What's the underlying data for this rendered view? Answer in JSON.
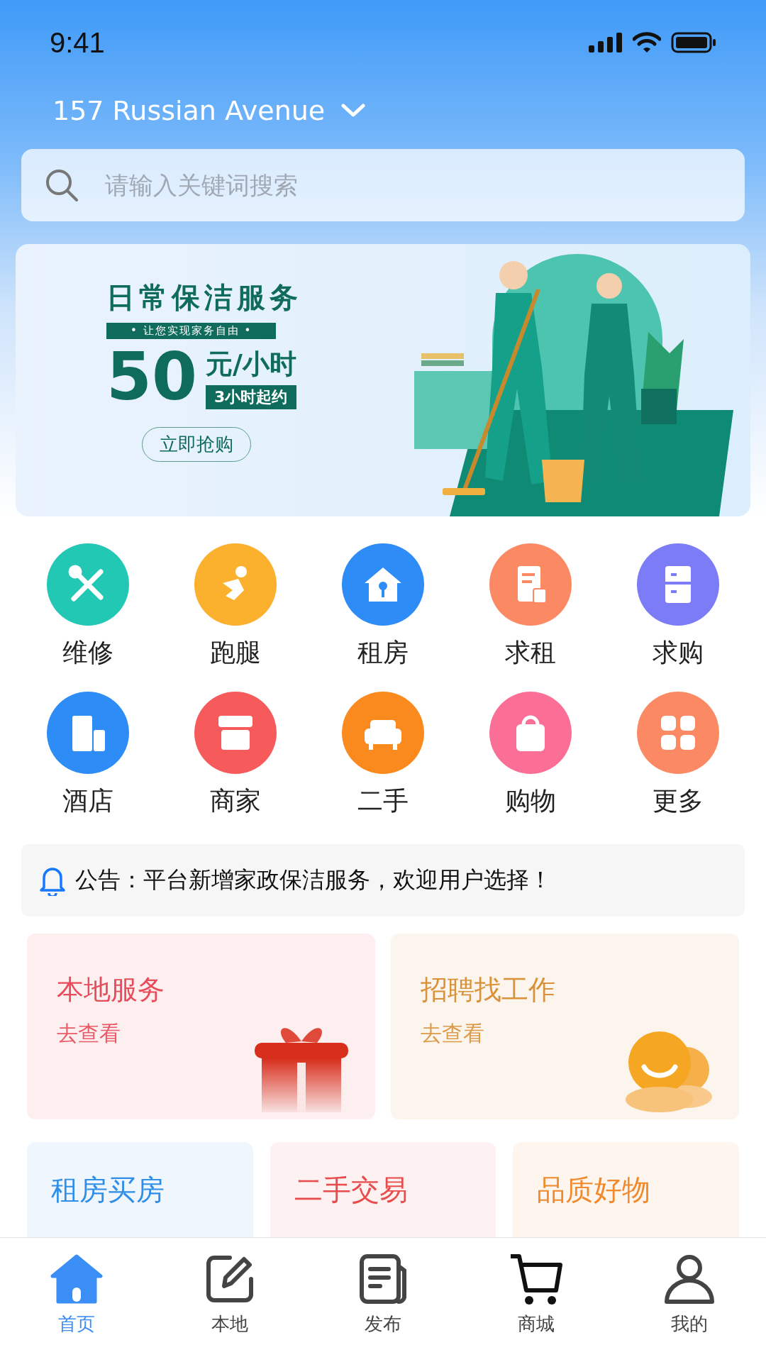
{
  "status_bar": {
    "time": "9:41"
  },
  "location": {
    "text": "157 Russian Avenue"
  },
  "search": {
    "placeholder": "请输入关键词搜索"
  },
  "banner": {
    "title": "日常保洁服务",
    "tagline": "• 让您实现家务自由 •",
    "price": "50",
    "unit": "元/小时",
    "note": "3小时起约",
    "button": "立即抢购"
  },
  "categories": [
    {
      "label": "维修",
      "kind": "wrench",
      "color": "#22c8b4"
    },
    {
      "label": "跑腿",
      "kind": "runner",
      "color": "#fbb12e"
    },
    {
      "label": "租房",
      "kind": "house",
      "color": "#2d8cf5"
    },
    {
      "label": "求租",
      "kind": "document",
      "color": "#fb8a64"
    },
    {
      "label": "求购",
      "kind": "cabinet",
      "color": "#7b7cf6"
    },
    {
      "label": "酒店",
      "kind": "building",
      "color": "#2d8cf5"
    },
    {
      "label": "商家",
      "kind": "shop",
      "color": "#f65a5a"
    },
    {
      "label": "二手",
      "kind": "sofa",
      "color": "#fb8a1e"
    },
    {
      "label": "购物",
      "kind": "bag",
      "color": "#fb6f96"
    },
    {
      "label": "更多",
      "kind": "grid",
      "color": "#fb8a64"
    }
  ],
  "notice": {
    "text": "公告：平台新增家政保洁服务，欢迎用户选择！"
  },
  "feature_cards": [
    {
      "title": "本地服务",
      "link": "去查看",
      "kind": "gift",
      "color": "#e84c5a"
    },
    {
      "title": "招聘找工作",
      "link": "去查看",
      "kind": "chat",
      "color": "#d9923a"
    }
  ],
  "mini_cards": [
    {
      "title": "租房买房",
      "color": "#2f8ee8"
    },
    {
      "title": "二手交易",
      "color": "#e84c4c"
    },
    {
      "title": "品质好物",
      "color": "#f08a2c"
    }
  ],
  "tab_bar": [
    {
      "label": "首页",
      "kind": "home",
      "selected": true
    },
    {
      "label": "本地",
      "kind": "edit",
      "selected": false
    },
    {
      "label": "发布",
      "kind": "doc",
      "selected": false
    },
    {
      "label": "商城",
      "kind": "cart",
      "selected": false
    },
    {
      "label": "我的",
      "kind": "user",
      "selected": false
    }
  ]
}
